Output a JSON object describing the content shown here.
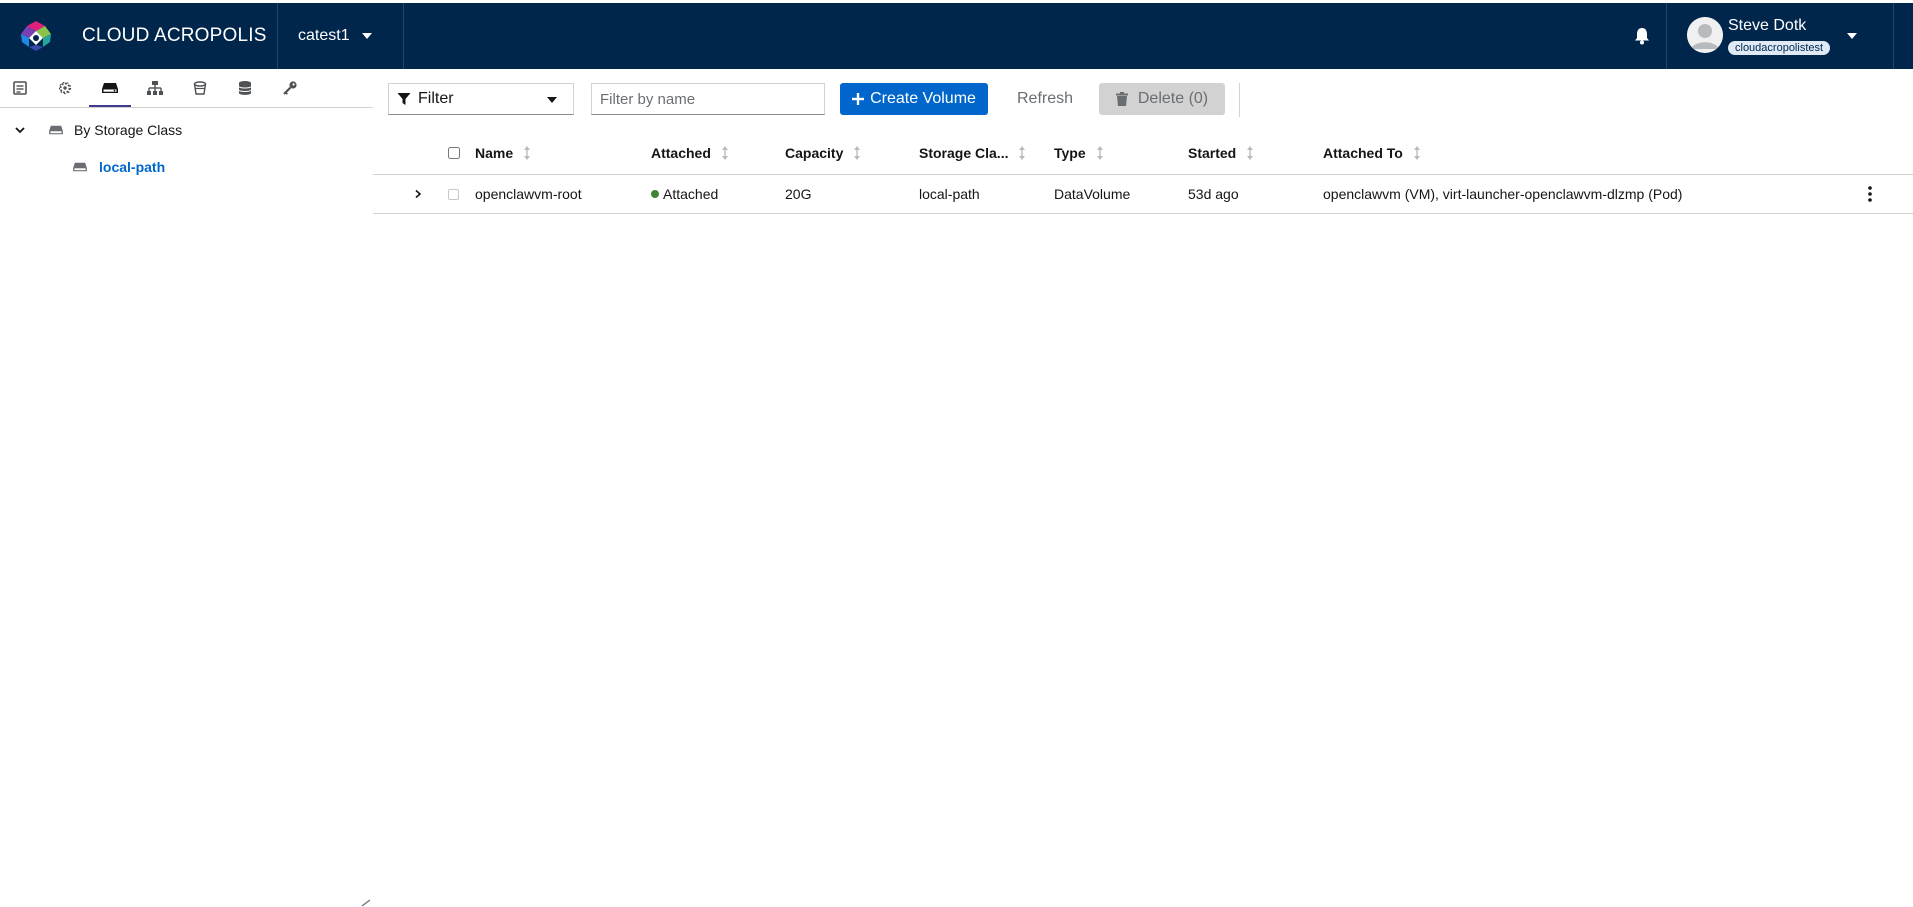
{
  "header": {
    "brand": "CLOUD ACROPOLIS",
    "project": "catest1",
    "user": {
      "name": "Steve Dotk",
      "org": "cloudacropolistest"
    },
    "colors": {
      "bar": "#00264c",
      "accent": "#0066cc"
    }
  },
  "sidebar": {
    "tabs": [
      {
        "icon": "server-icon"
      },
      {
        "icon": "cog-icon"
      },
      {
        "icon": "storage-icon",
        "active": true
      },
      {
        "icon": "network-icon"
      },
      {
        "icon": "bucket-icon"
      },
      {
        "icon": "database-icon"
      },
      {
        "icon": "key-icon"
      }
    ],
    "tree": {
      "group_label": "By Storage Class",
      "items": [
        {
          "label": "local-path"
        }
      ]
    }
  },
  "toolbar": {
    "filter_label": "Filter",
    "search_placeholder": "Filter by name",
    "create_label": "Create Volume",
    "refresh_label": "Refresh",
    "delete_label": "Delete (0)"
  },
  "table": {
    "columns": [
      "Name",
      "Attached",
      "Capacity",
      "Storage Cla...",
      "Type",
      "Started",
      "Attached To"
    ],
    "rows": [
      {
        "name": "openclawvm-root",
        "attached": "Attached",
        "capacity": "20G",
        "storage_class": "local-path",
        "type": "DataVolume",
        "started": "53d ago",
        "attached_to": "openclawvm (VM), virt-launcher-openclawvm-dlzmp (Pod)"
      }
    ]
  }
}
